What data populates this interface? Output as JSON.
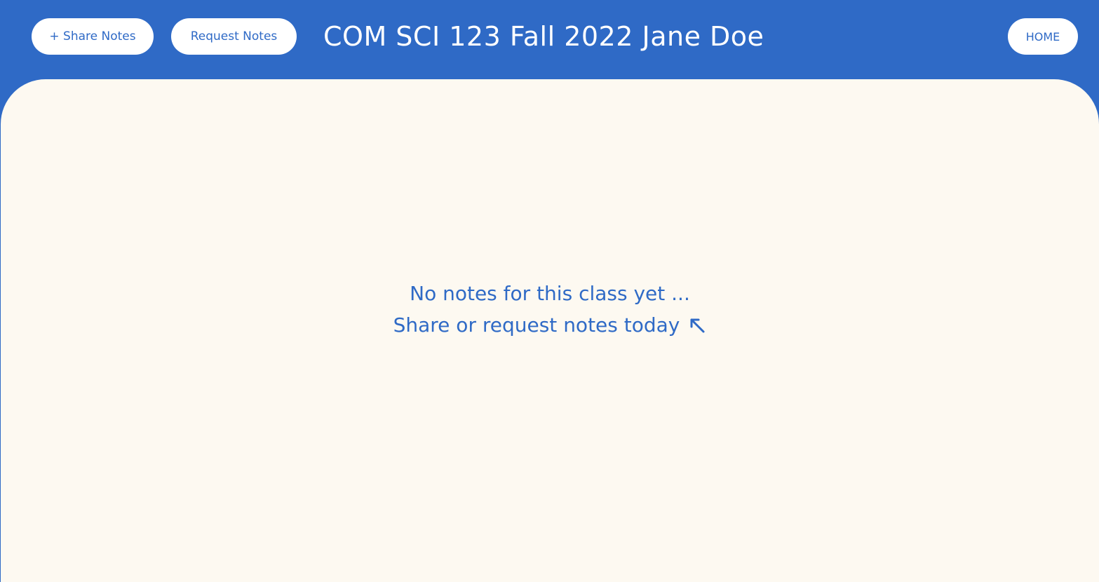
{
  "header": {
    "share_label": "+ Share Notes",
    "request_label": "Request Notes",
    "title": "COM SCI 123 Fall 2022 Jane Doe",
    "home_label": "HOME"
  },
  "main": {
    "empty_line1": "No notes for this class yet ...",
    "empty_line2": "Share or request notes today",
    "arrow_icon": "arrow-up-left-icon"
  },
  "colors": {
    "primary": "#2f6ac6",
    "background": "#fdf9f1",
    "button_bg": "#ffffff"
  }
}
